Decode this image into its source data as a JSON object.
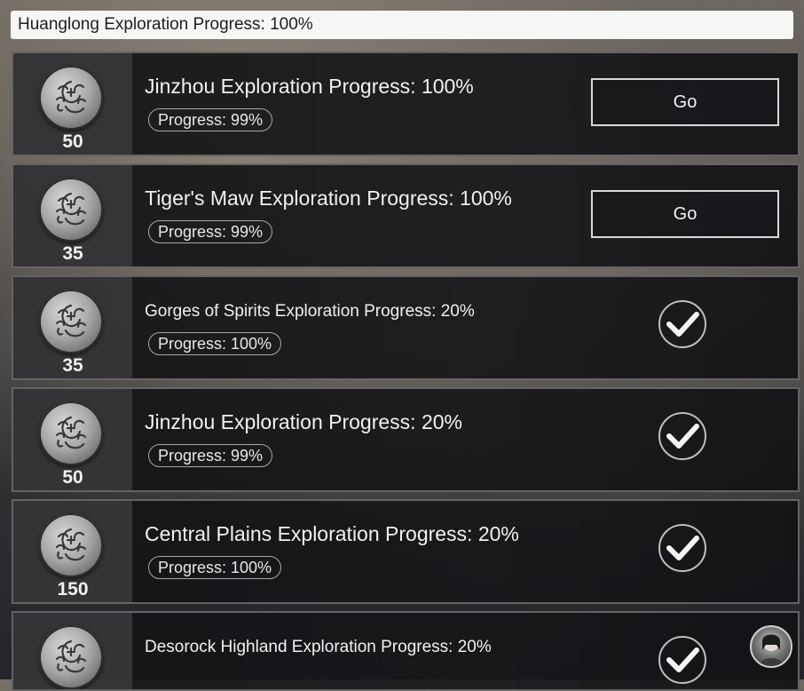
{
  "header": {
    "title": "Huanglong Exploration Progress: 100%"
  },
  "rows": [
    {
      "reward": "50",
      "title": "Jinzhou Exploration Progress: 100%",
      "progress": "Progress: 99%",
      "action": "Go"
    },
    {
      "reward": "35",
      "title": "Tiger's Maw Exploration Progress: 100%",
      "progress": "Progress: 99%",
      "action": "Go"
    },
    {
      "reward": "35",
      "title": "Gorges of Spirits Exploration Progress: 20%",
      "progress": "Progress: 100%",
      "action": "completed"
    },
    {
      "reward": "50",
      "title": "Jinzhou Exploration Progress: 20%",
      "progress": "Progress: 99%",
      "action": "completed"
    },
    {
      "reward": "150",
      "title": "Central Plains Exploration Progress: 20%",
      "progress": "Progress: 100%",
      "action": "completed"
    },
    {
      "reward": "",
      "title": "Desorock Highland Exploration Progress: 20%",
      "progress": "",
      "action": "completed"
    }
  ],
  "icons": {
    "reward": "dragon-coin-icon",
    "done": "checkmark-icon",
    "user": "avatar-icon"
  }
}
